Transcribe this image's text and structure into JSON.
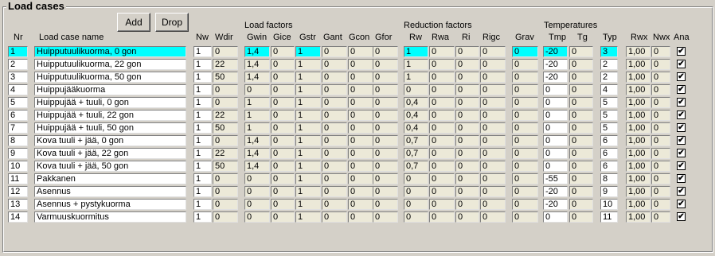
{
  "title": "Load cases",
  "buttons": {
    "add": "Add",
    "drop": "Drop"
  },
  "groups": {
    "load_factors": "Load factors",
    "reduction_factors": "Reduction factors",
    "temperatures": "Temperatures"
  },
  "columns": [
    "Nr",
    "Load case name",
    "Nw",
    "Wdir",
    "Gwin",
    "Gice",
    "Gstr",
    "Gant",
    "Gcon",
    "Gfor",
    "Rw",
    "Rwa",
    "Ri",
    "Rigc",
    "Grav",
    "Tmp",
    "Tg",
    "Typ",
    "Rwx",
    "Nwx",
    "Ana"
  ],
  "rows": [
    [
      "1",
      "Huipputuulikuorma, 0 gon",
      "1",
      "0",
      "1,4",
      "0",
      "1",
      "0",
      "0",
      "0",
      "1",
      "0",
      "0",
      "0",
      "0",
      "-20",
      "0",
      "3",
      "1,00",
      "0",
      true
    ],
    [
      "2",
      "Huipputuulikuorma, 22 gon",
      "1",
      "22",
      "1,4",
      "0",
      "1",
      "0",
      "0",
      "0",
      "1",
      "0",
      "0",
      "0",
      "0",
      "-20",
      "0",
      "2",
      "1,00",
      "0",
      true
    ],
    [
      "3",
      "Huipputuulikuorma, 50 gon",
      "1",
      "50",
      "1,4",
      "0",
      "1",
      "0",
      "0",
      "0",
      "1",
      "0",
      "0",
      "0",
      "0",
      "-20",
      "0",
      "2",
      "1,00",
      "0",
      true
    ],
    [
      "4",
      "Huippujääkuorma",
      "1",
      "0",
      "0",
      "0",
      "1",
      "0",
      "0",
      "0",
      "0",
      "0",
      "0",
      "0",
      "0",
      "0",
      "0",
      "4",
      "1,00",
      "0",
      true
    ],
    [
      "5",
      "Huippujää + tuuli, 0 gon",
      "1",
      "0",
      "1",
      "0",
      "1",
      "0",
      "0",
      "0",
      "0,4",
      "0",
      "0",
      "0",
      "0",
      "0",
      "0",
      "5",
      "1,00",
      "0",
      true
    ],
    [
      "6",
      "Huippujää + tuuli, 22 gon",
      "1",
      "22",
      "1",
      "0",
      "1",
      "0",
      "0",
      "0",
      "0,4",
      "0",
      "0",
      "0",
      "0",
      "0",
      "0",
      "5",
      "1,00",
      "0",
      true
    ],
    [
      "7",
      "Huippujää + tuuli, 50 gon",
      "1",
      "50",
      "1",
      "0",
      "1",
      "0",
      "0",
      "0",
      "0,4",
      "0",
      "0",
      "0",
      "0",
      "0",
      "0",
      "5",
      "1,00",
      "0",
      true
    ],
    [
      "8",
      "Kova tuuli + jää, 0 gon",
      "1",
      "0",
      "1,4",
      "0",
      "1",
      "0",
      "0",
      "0",
      "0,7",
      "0",
      "0",
      "0",
      "0",
      "0",
      "0",
      "6",
      "1,00",
      "0",
      true
    ],
    [
      "9",
      "Kova tuuli + jää, 22 gon",
      "1",
      "22",
      "1,4",
      "0",
      "1",
      "0",
      "0",
      "0",
      "0,7",
      "0",
      "0",
      "0",
      "0",
      "0",
      "0",
      "6",
      "1,00",
      "0",
      true
    ],
    [
      "10",
      "Kova tuuli + jää, 50 gon",
      "1",
      "50",
      "1,4",
      "0",
      "1",
      "0",
      "0",
      "0",
      "0,7",
      "0",
      "0",
      "0",
      "0",
      "0",
      "0",
      "6",
      "1,00",
      "0",
      true
    ],
    [
      "11",
      "Pakkanen",
      "1",
      "0",
      "0",
      "0",
      "1",
      "0",
      "0",
      "0",
      "0",
      "0",
      "0",
      "0",
      "0",
      "-55",
      "0",
      "8",
      "1,00",
      "0",
      true
    ],
    [
      "12",
      "Asennus",
      "1",
      "0",
      "0",
      "0",
      "1",
      "0",
      "0",
      "0",
      "0",
      "0",
      "0",
      "0",
      "0",
      "-20",
      "0",
      "9",
      "1,00",
      "0",
      true
    ],
    [
      "13",
      "Asennus + pystykuorma",
      "1",
      "0",
      "0",
      "0",
      "1",
      "0",
      "0",
      "0",
      "0",
      "0",
      "0",
      "0",
      "0",
      "-20",
      "0",
      "10",
      "1,00",
      "0",
      true
    ],
    [
      "14",
      "Varmuuskuormitus",
      "1",
      "0",
      "0",
      "0",
      "1",
      "0",
      "0",
      "0",
      "0",
      "0",
      "0",
      "0",
      "0",
      "0",
      "0",
      "11",
      "1,00",
      "0",
      true
    ]
  ],
  "selected_row": 0,
  "colors": {
    "selected": "#00ffff",
    "readonly": "#ece9d8",
    "background": "#d4d0c8"
  }
}
